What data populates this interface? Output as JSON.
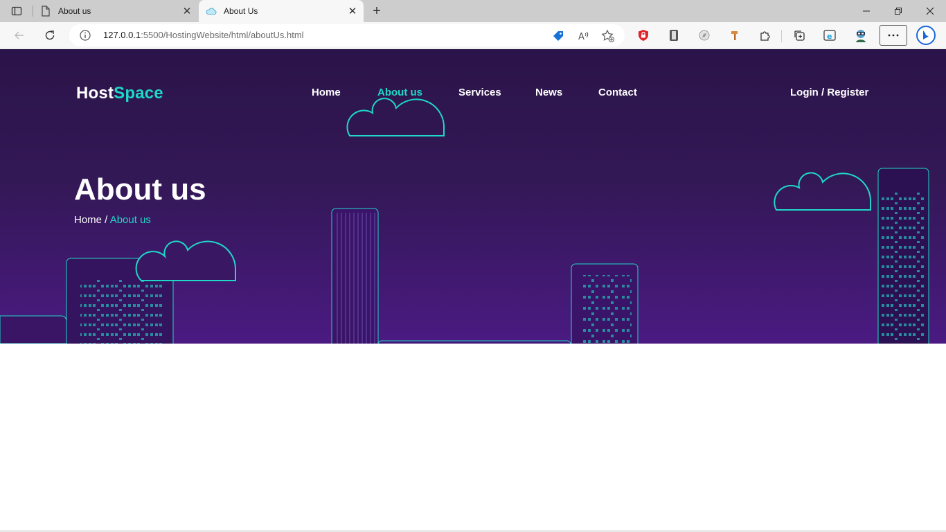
{
  "browser": {
    "tabs": [
      {
        "title": "About us",
        "active": false
      },
      {
        "title": "About Us",
        "active": true
      }
    ],
    "address": {
      "host": "127.0.0.1",
      "path": ":5500/HostingWebsite/html/aboutUs.html"
    }
  },
  "site": {
    "logo": {
      "part1": "Host",
      "part2": "Space"
    },
    "nav": [
      {
        "label": "Home"
      },
      {
        "label": "About us"
      },
      {
        "label": "Services"
      },
      {
        "label": "News"
      },
      {
        "label": "Contact"
      }
    ],
    "auth_label": "Login / Register",
    "hero": {
      "title": "About us",
      "breadcrumb": {
        "home": "Home",
        "separator": " / ",
        "current": "About us"
      }
    }
  },
  "colors": {
    "accent": "#1fd8c7",
    "hero_top": "#2b1449",
    "hero_bottom": "#4a1a82",
    "building_outline": "#1fd8c7",
    "window": "#2a8aa0"
  }
}
